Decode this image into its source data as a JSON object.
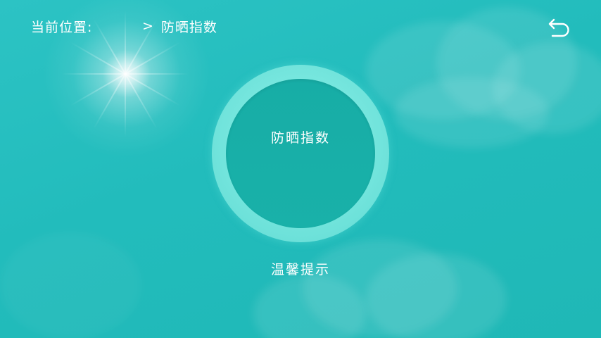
{
  "header": {
    "location_label": "当前位置:",
    "location_separator": ">",
    "location_current": "防晒指数",
    "back_icon": "back-arrow-icon"
  },
  "main": {
    "ring_title": "防晒指数",
    "tips_label": "温馨提示"
  },
  "colors": {
    "background": "#22bcbc",
    "ring_outer": "#72e4dc",
    "ring_inner": "#17ada6",
    "text": "#ffffff"
  }
}
